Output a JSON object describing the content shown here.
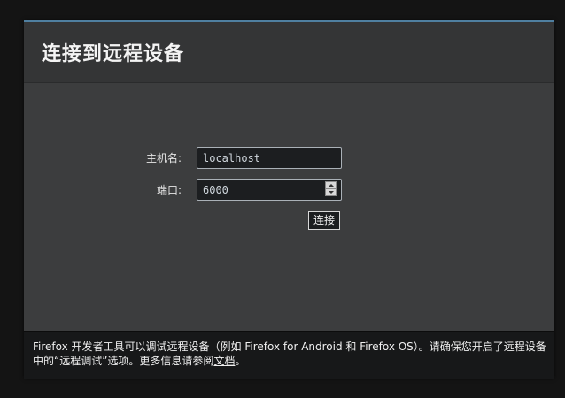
{
  "dialog": {
    "title": "连接到远程设备"
  },
  "form": {
    "host_label": "主机名:",
    "host_value": "localhost",
    "port_label": "端口:",
    "port_value": "6000",
    "connect_label": "连接"
  },
  "footer": {
    "text_before_link": "Firefox 开发者工具可以调试远程设备（例如 Firefox for Android 和 Firefox OS）。请确保您开启了远程设备中的“远程调试”选项。更多信息请参阅",
    "link_label": "文档",
    "text_after_link": "。"
  },
  "colors": {
    "accent_border": "#4f7fa0",
    "dialog_bg": "#3c3d3e",
    "footer_bg": "#171819"
  }
}
